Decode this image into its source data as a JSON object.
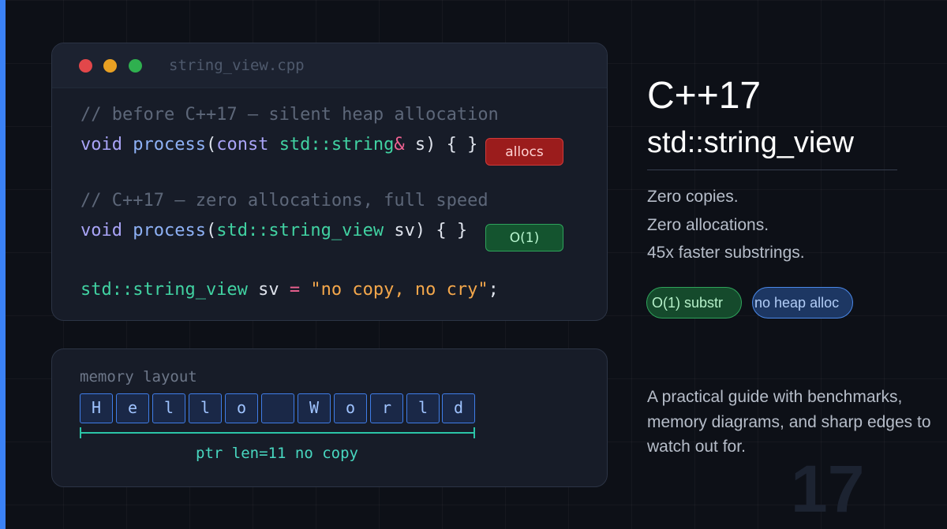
{
  "editor": {
    "filename": "string_view.cpp",
    "comment_before": "// before C++17 — silent heap allocation",
    "line1": {
      "kw1": "void",
      "fn": "process",
      "paren_open": "(",
      "kw2": "const",
      "type": "std::string",
      "amp": "&",
      "rest": " s) { ",
      "hidden_tail": "}"
    },
    "comment_after": "// C++17 — zero allocations, full speed",
    "line2": {
      "kw1": "void",
      "fn": "process",
      "paren_open": "(",
      "type": "std::string_view",
      "rest": " sv) { }"
    },
    "line3": {
      "type": "std::string_view",
      "name": " sv ",
      "op": "=",
      "str": " \"no copy, no cry\"",
      "end": ";"
    },
    "badge_allocs": "allocs",
    "badge_o1": "O(1)"
  },
  "memory": {
    "label": "memory layout",
    "cells": [
      "H",
      "e",
      "l",
      "l",
      "o",
      " ",
      "W",
      "o",
      "r",
      "l",
      "d"
    ],
    "pointer_label": "ptr len=11 no copy"
  },
  "info": {
    "kicker": "C++17",
    "heading": "std::string_view",
    "features": [
      "Zero copies.",
      "Zero allocations.",
      "45x faster substrings."
    ],
    "pills": [
      "O(1) substr",
      "no heap alloc"
    ],
    "paragraph": "A practical guide with benchmarks, memory diagrams, and sharp edges to watch out for.",
    "watermark": "17"
  },
  "colors": {
    "background": "#0d1017",
    "accent": "#3b82f6",
    "panel": "#171c28",
    "keyword": "#a9a4f7",
    "function": "#8eb1f5",
    "type": "#41d2a2",
    "string": "#f4a74b",
    "badge_red": "#9b1c1c",
    "badge_green": "#14542f"
  }
}
